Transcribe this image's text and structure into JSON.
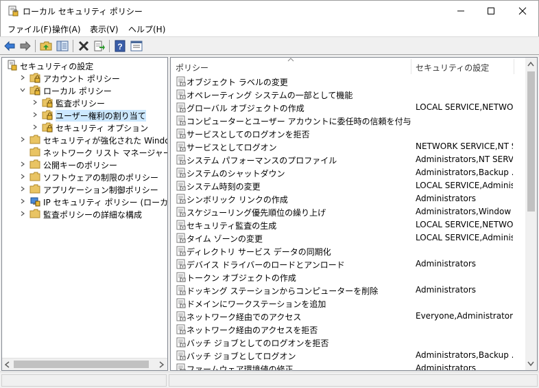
{
  "window": {
    "title": "ローカル セキュリティ ポリシー",
    "icon": "security-policy-app-icon"
  },
  "menu": {
    "items": [
      "ファイル(F)",
      "操作(A)",
      "表示(V)",
      "ヘルプ(H)"
    ]
  },
  "toolbar": {
    "buttons": [
      "back-arrow-icon",
      "forward-arrow-icon",
      "up-folder-icon",
      "show-hide-tree-icon",
      "delete-icon",
      "export-list-icon",
      "help-icon",
      "properties-icon"
    ]
  },
  "tree": {
    "items": [
      {
        "label": "セキュリティの設定",
        "icon": "security-settings-icon"
      },
      {
        "label": "アカウント ポリシー",
        "icon": "folder-lock-icon"
      },
      {
        "label": "ローカル ポリシー",
        "icon": "folder-lock-icon"
      },
      {
        "label": "監査ポリシー",
        "icon": "folder-lock-icon"
      },
      {
        "label": "ユーザー権利の割り当て",
        "icon": "folder-lock-icon"
      },
      {
        "label": "セキュリティ オプション",
        "icon": "folder-lock-icon"
      },
      {
        "label": "セキュリティが強化された Windows Defender",
        "icon": "folder-icon"
      },
      {
        "label": "ネットワーク リスト マネージャー ポリシー",
        "icon": "folder-icon"
      },
      {
        "label": "公開キーのポリシー",
        "icon": "folder-icon"
      },
      {
        "label": "ソフトウェアの制限のポリシー",
        "icon": "folder-icon"
      },
      {
        "label": "アプリケーション制御ポリシー",
        "icon": "folder-icon"
      },
      {
        "label": "IP セキュリティ ポリシー (ローカル コンピューター)",
        "icon": "ip-security-icon"
      },
      {
        "label": "監査ポリシーの詳細な構成",
        "icon": "folder-icon"
      }
    ]
  },
  "list": {
    "columns": [
      "ポリシー",
      "セキュリティの設定"
    ],
    "rows": [
      {
        "name": "オブジェクト ラベルの変更",
        "value": ""
      },
      {
        "name": "オペレーティング システムの一部として機能",
        "value": ""
      },
      {
        "name": "グローバル オブジェクトの作成",
        "value": "LOCAL SERVICE,NETWO..."
      },
      {
        "name": "コンピューターとユーザー アカウントに委任時の信頼を付与",
        "value": ""
      },
      {
        "name": "サービスとしてのログオンを拒否",
        "value": ""
      },
      {
        "name": "サービスとしてログオン",
        "value": "NETWORK SERVICE,NT S..."
      },
      {
        "name": "システム パフォーマンスのプロファイル",
        "value": "Administrators,NT SERVI..."
      },
      {
        "name": "システムのシャットダウン",
        "value": "Administrators,Backup ..."
      },
      {
        "name": "システム時刻の変更",
        "value": "LOCAL SERVICE,Adminis..."
      },
      {
        "name": "シンボリック リンクの作成",
        "value": "Administrators"
      },
      {
        "name": "スケジューリング優先順位の繰り上げ",
        "value": "Administrators,Window ..."
      },
      {
        "name": "セキュリティ監査の生成",
        "value": "LOCAL SERVICE,NETWO..."
      },
      {
        "name": "タイム ゾーンの変更",
        "value": "LOCAL SERVICE,Adminis..."
      },
      {
        "name": "ディレクトリ サービス データの同期化",
        "value": ""
      },
      {
        "name": "デバイス ドライバーのロードとアンロード",
        "value": "Administrators"
      },
      {
        "name": "トークン オブジェクトの作成",
        "value": ""
      },
      {
        "name": "ドッキング ステーションからコンピューターを削除",
        "value": "Administrators"
      },
      {
        "name": "ドメインにワークステーションを追加",
        "value": ""
      },
      {
        "name": "ネットワーク経由でのアクセス",
        "value": "Everyone,Administrators..."
      },
      {
        "name": "ネットワーク経由のアクセスを拒否",
        "value": ""
      },
      {
        "name": "バッチ ジョブとしてのログオンを拒否",
        "value": ""
      },
      {
        "name": "バッチ ジョブとしてログオン",
        "value": "Administrators,Backup ..."
      },
      {
        "name": "ファームウェア環境値の修正",
        "value": "Administrators"
      }
    ]
  }
}
